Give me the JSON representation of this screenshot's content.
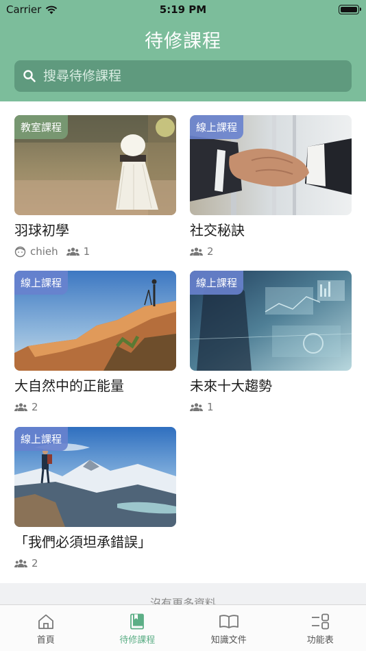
{
  "status_bar": {
    "carrier": "Carrier",
    "time": "5:19 PM"
  },
  "header": {
    "title": "待修課程"
  },
  "search": {
    "placeholder": "搜尋待修課程"
  },
  "courses": [
    {
      "tag": "教室課程",
      "title": "羽球初學",
      "instructor": "chieh",
      "members": "1"
    },
    {
      "tag": "線上課程",
      "title": "社交秘訣",
      "members": "2"
    },
    {
      "tag": "線上課程",
      "title": "大自然中的正能量",
      "members": "2"
    },
    {
      "tag": "線上課程",
      "title": "未來十大趨勢",
      "members": "1"
    },
    {
      "tag": "線上課程",
      "title": "「我們必須坦承錯誤」",
      "members": "2"
    }
  ],
  "footer": {
    "no_more": "沒有更多資料"
  },
  "tabbar": [
    {
      "label": "首頁",
      "icon": "home-icon"
    },
    {
      "label": "待修課程",
      "icon": "book-icon",
      "active": true
    },
    {
      "label": "知識文件",
      "icon": "open-book-icon"
    },
    {
      "label": "功能表",
      "icon": "menu-grid-icon"
    }
  ],
  "colors": {
    "header": "#7cbd9b",
    "search_bg": "#5f9a7e",
    "tab_active": "#5cae86",
    "tag_online": "#6882ce",
    "tag_classroom": "#7a9e76"
  }
}
